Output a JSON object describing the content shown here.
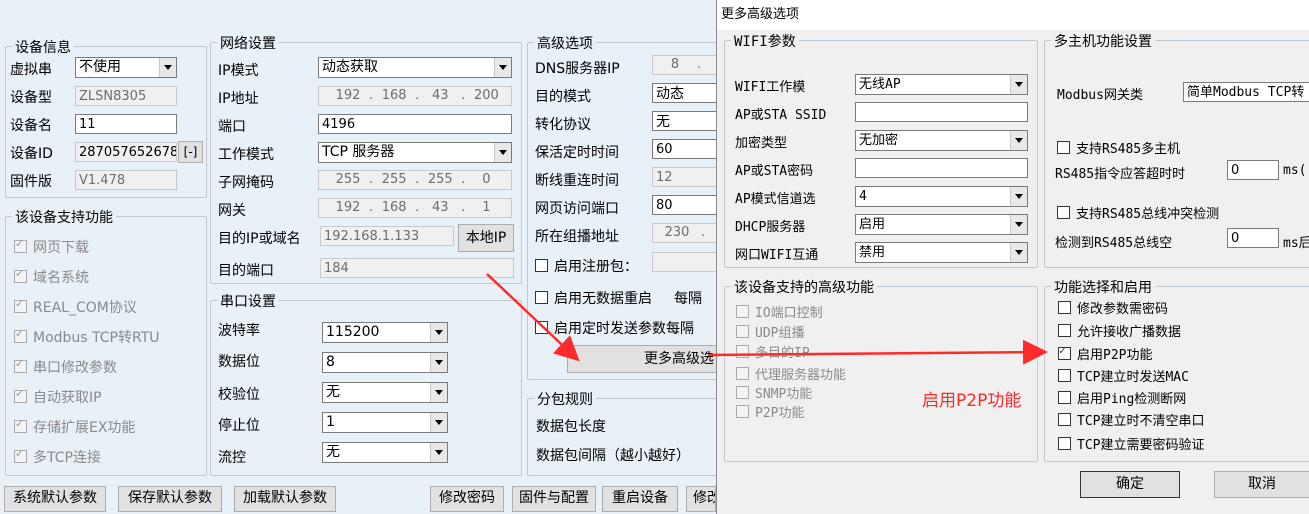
{
  "main": {
    "device_info": {
      "title": "设备信息",
      "virtual_serial_label": "虚拟串",
      "virtual_serial_value": "不使用",
      "device_model_label": "设备型",
      "device_model_value": "ZLSN8305",
      "device_name_label": "设备名",
      "device_name_value": "11",
      "device_id_label": "设备ID",
      "device_id_value": "287057652678",
      "device_id_btn": "[-]",
      "firmware_label": "固件版",
      "firmware_value": "V1.478"
    },
    "supported": {
      "title": "该设备支持功能",
      "items": [
        "网页下载",
        "域名系统",
        "REAL_COM协议",
        "Modbus TCP转RTU",
        "串口修改参数",
        "自动获取IP",
        "存储扩展EX功能",
        "多TCP连接"
      ]
    },
    "network": {
      "title": "网络设置",
      "ip_mode_label": "IP模式",
      "ip_mode_value": "动态获取",
      "ip_label": "IP地址",
      "ip": [
        "192",
        "168",
        "43",
        "200"
      ],
      "port_label": "端口",
      "port_value": "4196",
      "work_mode_label": "工作模式",
      "work_mode_value": "TCP 服务器",
      "mask_label": "子网掩码",
      "mask": [
        "255",
        "255",
        "255",
        "0"
      ],
      "gateway_label": "网关",
      "gateway": [
        "192",
        "168",
        "43",
        "1"
      ],
      "dest_label": "目的IP或域名",
      "dest_value": "192.168.1.133",
      "local_ip_btn": "本地IP",
      "dest_port_label": "目的端口",
      "dest_port_value": "184"
    },
    "serial": {
      "title": "串口设置",
      "baud_label": "波特率",
      "baud_value": "115200",
      "data_bits_label": "数据位",
      "data_bits_value": "8",
      "parity_label": "校验位",
      "parity_value": "无",
      "stop_bits_label": "停止位",
      "stop_bits_value": "1",
      "flow_label": "流控",
      "flow_value": "无"
    },
    "advanced": {
      "title": "高级选项",
      "dns_label": "DNS服务器IP",
      "dns_partial": [
        "8",
        "."
      ],
      "dest_mode_label": "目的模式",
      "dest_mode_value": "动态",
      "protocol_label": "转化协议",
      "protocol_value": "无",
      "keepalive_label": "保活定时时间",
      "keepalive_value": "60",
      "reconnect_label": "断线重连时间",
      "reconnect_value": "12",
      "web_port_label": "网页访问端口",
      "web_port_value": "80",
      "multicast_label": "所在组播地址",
      "multicast_partial": [
        "230",
        "."
      ],
      "register_label": "启用注册包：",
      "nodata_label": "启用无数据重启",
      "nodata_suffix": "每隔",
      "timed_label": "启用定时发送参数每隔",
      "more_btn": "更多高级选"
    },
    "packet": {
      "title": "分包规则",
      "length_label": "数据包长度",
      "interval_label": "数据包间隔（越小越好）"
    },
    "buttons": [
      "系统默认参数",
      "保存默认参数",
      "加载默认参数",
      "修改密码",
      "固件与配置",
      "重启设备",
      "修改"
    ]
  },
  "dialog": {
    "title": "更多高级选项",
    "wifi": {
      "title": "WIFI参数",
      "work_mode_label": "WIFI工作模",
      "work_mode_value": "无线AP",
      "ssid_label": "AP或STA SSID",
      "ssid_value": "",
      "enc_label": "加密类型",
      "enc_value": "无加密",
      "pwd_label": "AP或STA密码",
      "pwd_value": "",
      "channel_label": "AP模式信道选",
      "channel_value": "4",
      "dhcp_label": "DHCP服务器",
      "dhcp_value": "启用",
      "bridge_label": "网口WIFI互通",
      "bridge_value": "禁用"
    },
    "adv_features": {
      "title": "该设备支持的高级功能",
      "items": [
        "IO端口控制",
        "UDP组播",
        "多目的IP",
        "代理服务器功能",
        "SNMP功能",
        "P2P功能"
      ]
    },
    "multi_host": {
      "title": "多主机功能设置",
      "gateway_label": "Modbus网关类",
      "gateway_value": "简单Modbus TCP转",
      "rs485_multi_label": "支持RS485多主机",
      "timeout_label": "RS485指令应答超时时",
      "timeout_value": "0",
      "timeout_unit": "ms(",
      "conflict_label": "支持RS485总线冲突检测",
      "idle_label": "检测到RS485总线空",
      "idle_value": "0",
      "idle_unit": "ms后"
    },
    "functions": {
      "title": "功能选择和启用",
      "items": [
        {
          "label": "修改参数需密码",
          "checked": false
        },
        {
          "label": "允许接收广播数据",
          "checked": false
        },
        {
          "label": "启用P2P功能",
          "checked": true
        },
        {
          "label": "TCP建立时发送MAC",
          "checked": false
        },
        {
          "label": "启用Ping检测断网",
          "checked": false
        },
        {
          "label": "TCP建立时不清空串口",
          "checked": false
        },
        {
          "label": "TCP建立需要密码验证",
          "checked": false
        }
      ]
    },
    "ok_btn": "确定",
    "cancel_btn": "取消"
  },
  "annotation": {
    "text": "启用P2P功能",
    "color": "#ff2a2a"
  }
}
